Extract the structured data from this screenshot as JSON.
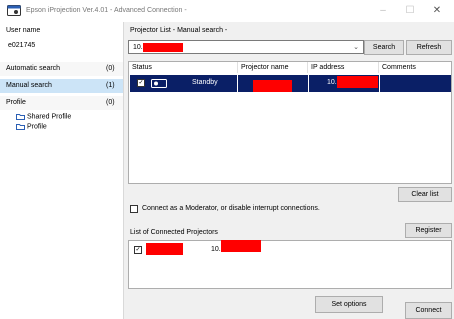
{
  "window": {
    "title": "Epson iProjection Ver.4.01 - Advanced Connection -",
    "minimize": "–",
    "maximize": "☐",
    "close": "✕"
  },
  "sidebar": {
    "user_name_label": "User name",
    "user_name_value": "e021745",
    "items": [
      {
        "label": "Automatic search",
        "count": "(0)"
      },
      {
        "label": "Manual search",
        "count": "(1)"
      },
      {
        "label": "Profile",
        "count": "(0)"
      }
    ],
    "tree": [
      "Shared Profile",
      "Profile"
    ]
  },
  "main": {
    "list_title": "Projector List - Manual search -",
    "search_value": "10.",
    "search_button": "Search",
    "refresh_button": "Refresh",
    "columns": [
      "Status",
      "Projector name",
      "IP address",
      "Comments"
    ],
    "rows": [
      {
        "status": "Standby",
        "ip_prefix": "10."
      }
    ],
    "clear_list_button": "Clear list",
    "moderator_label": "Connect as a Moderator, or disable interrupt connections.",
    "connected_title": "List of Connected Projectors",
    "register_button": "Register",
    "connected_rows": [
      {
        "ip_prefix": "10."
      }
    ],
    "set_options_button": "Set options",
    "connect_button": "Connect"
  },
  "colors": {
    "selection": "#0a1f66",
    "sidebar_selected": "#cce4f7",
    "redaction": "#ff0000"
  },
  "icons": {
    "app": "projector-app-icon",
    "folder": "folder-icon",
    "projector": "projector-icon"
  }
}
